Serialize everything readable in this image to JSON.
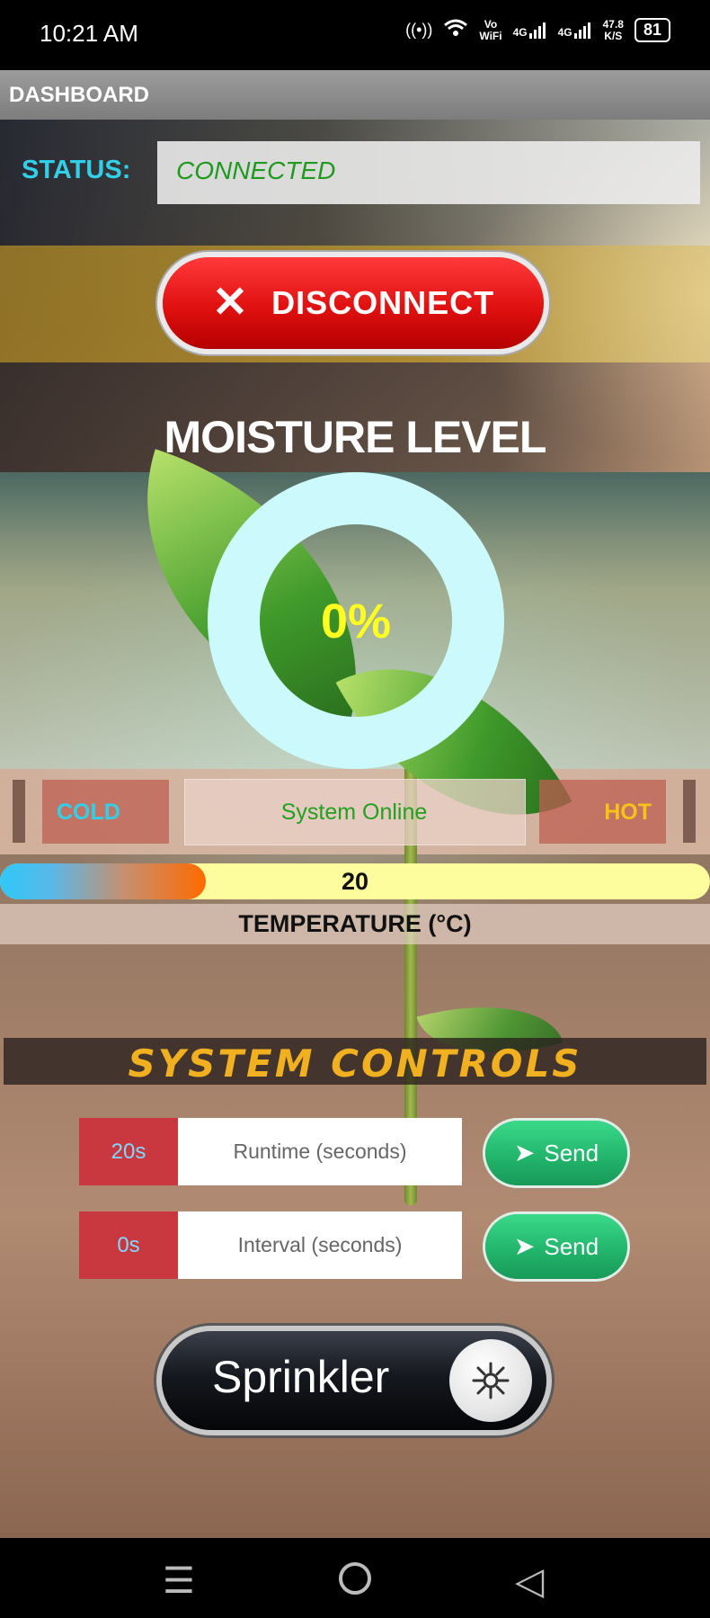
{
  "statusbar": {
    "time": "10:21 AM",
    "hotspot_icon": "hotspot-icon",
    "wifi_icon": "wifi-icon",
    "vowifi": "Vo\nWiFi",
    "net1": "4G",
    "net2": "4G",
    "speed": "47.8\nK/S",
    "battery": "81"
  },
  "header": {
    "title": "DASHBOARD"
  },
  "status": {
    "label": "STATUS:",
    "value": "CONNECTED"
  },
  "disconnect": {
    "icon": "close-icon",
    "label": "DISCONNECT"
  },
  "moisture": {
    "title": "MOISTURE LEVEL",
    "value": "0%",
    "level_fraction": 0.0
  },
  "temperature": {
    "cold_label": "COLD",
    "status_text": "System Online",
    "hot_label": "HOT",
    "value": "20",
    "fill_fraction": 0.29,
    "caption": "TEMPERATURE (°C)"
  },
  "controls": {
    "title": "SYSTEM CONTROLS",
    "runtime": {
      "value": "20s",
      "placeholder": "Runtime (seconds)",
      "send_label": "Send"
    },
    "interval": {
      "value": "0s",
      "placeholder": "Interval (seconds)",
      "send_label": "Send"
    }
  },
  "sprinkler": {
    "label": "Sprinkler",
    "icon": "sprinkler-icon"
  },
  "navbar": {
    "menu_icon": "menu-icon",
    "home_icon": "home-icon",
    "back_icon": "back-icon"
  },
  "colors": {
    "accent_cyan": "#32d0e8",
    "connected_green": "#1f9a1f",
    "disconnect_red": "#e01010",
    "ring": "#ccfafc",
    "moisture_text": "#ffff20",
    "controls_gold": "#f0b020",
    "send_green": "#21b36a"
  }
}
